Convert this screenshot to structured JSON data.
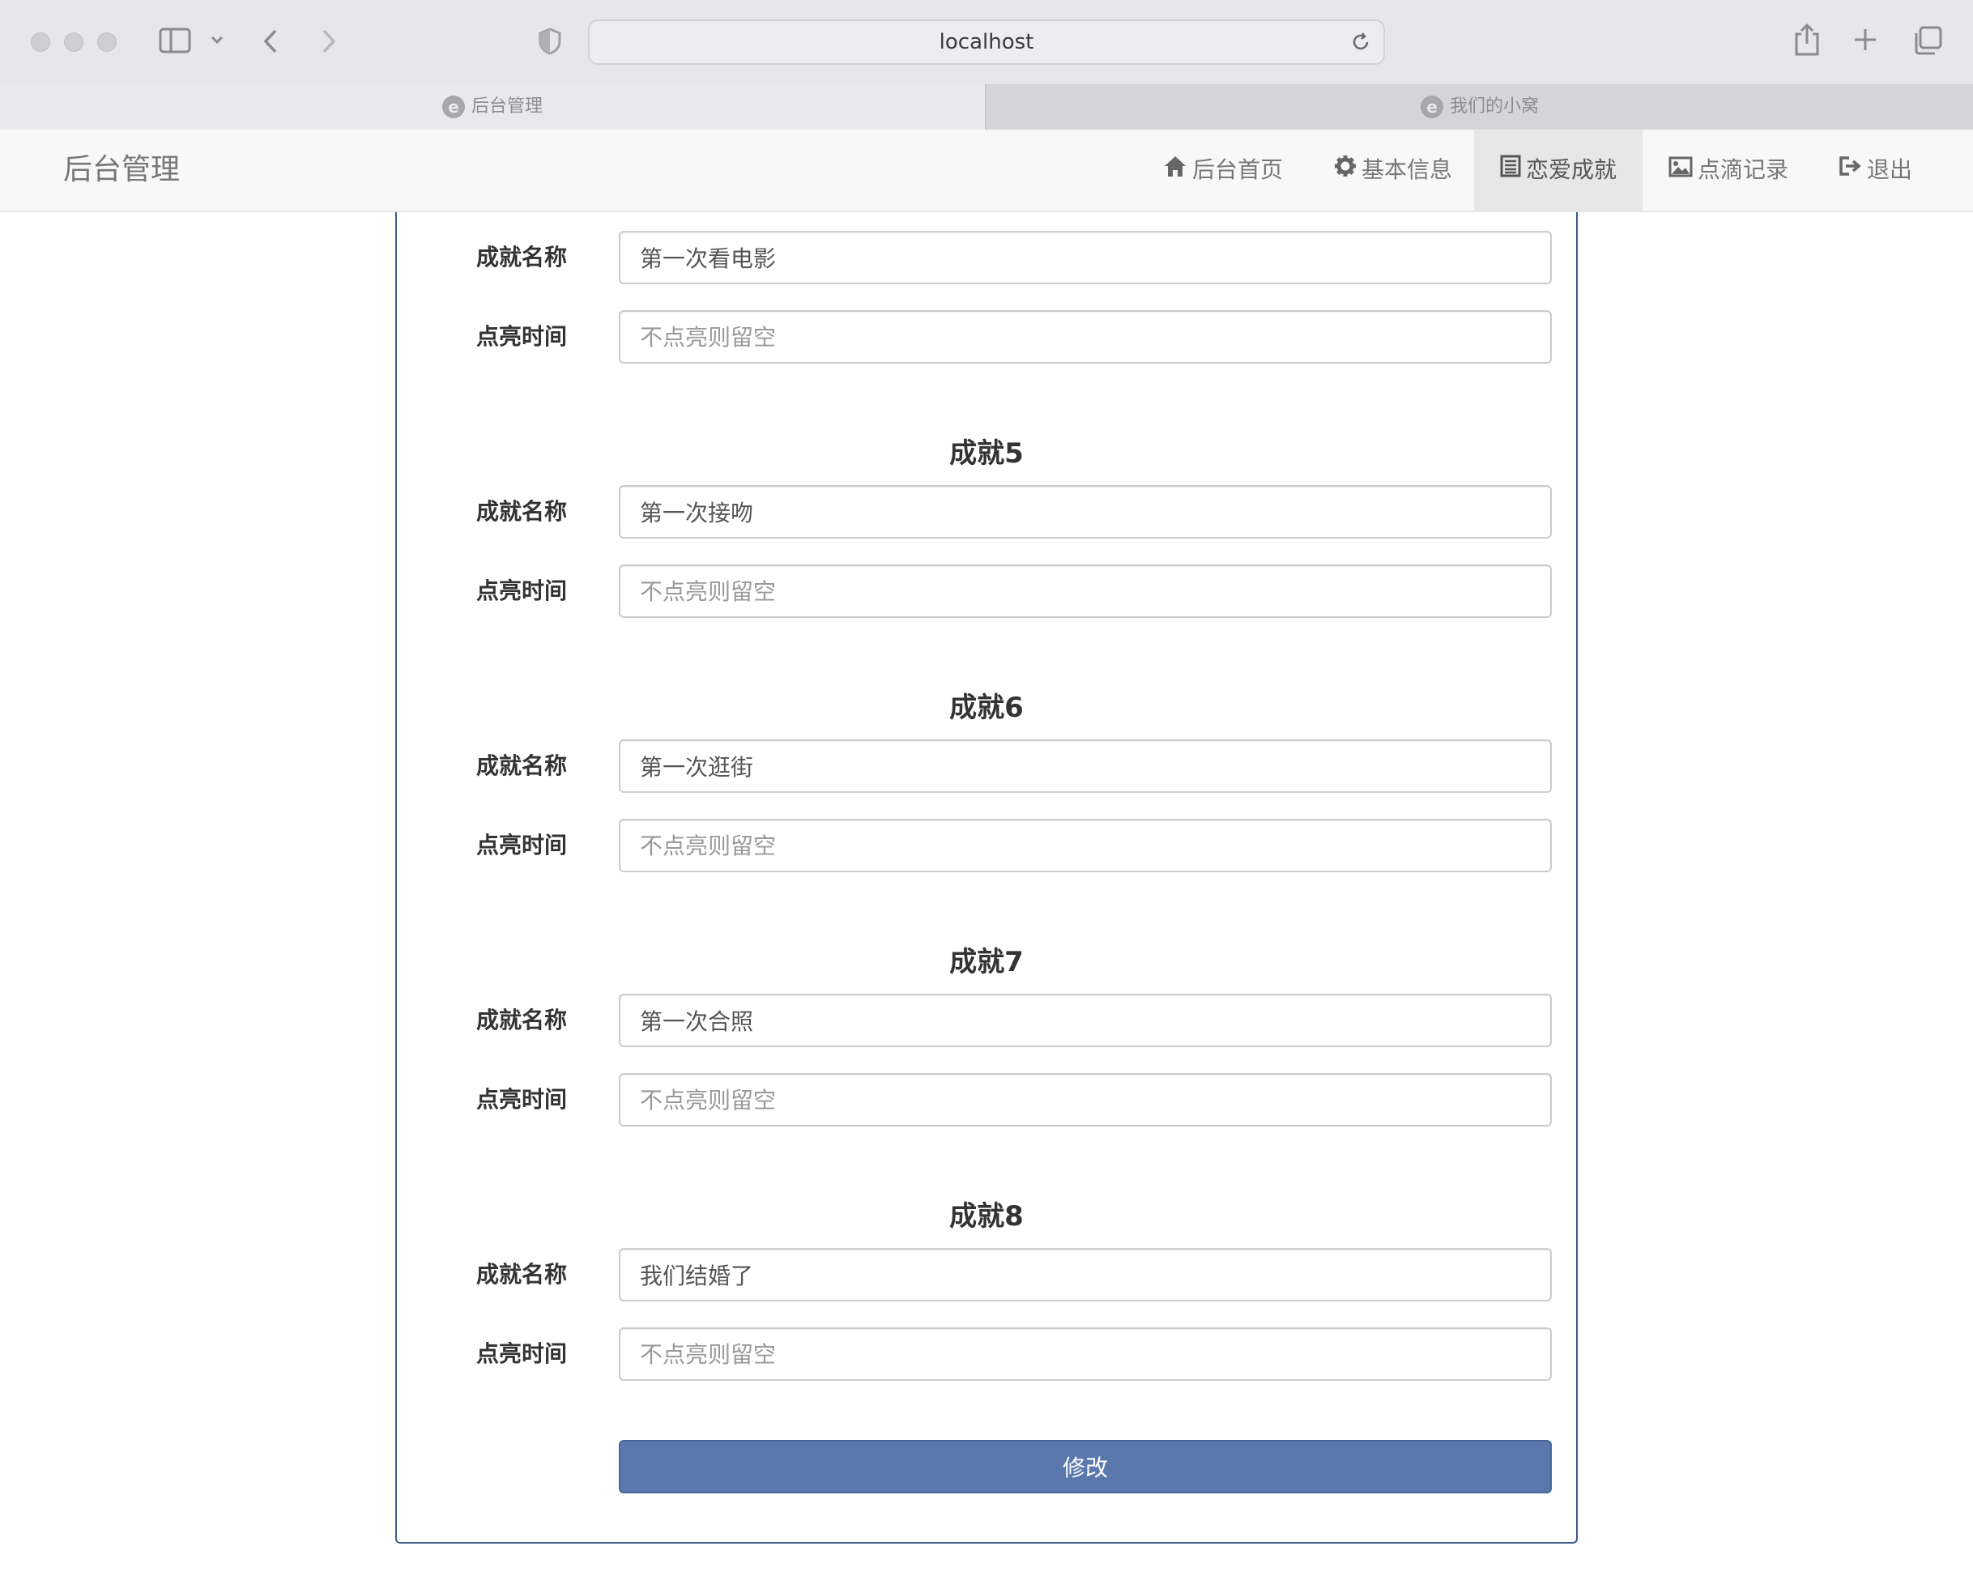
{
  "browser": {
    "url": "localhost",
    "tabs": [
      {
        "label": "后台管理"
      },
      {
        "label": "我们的小窝"
      }
    ]
  },
  "navbar": {
    "brand": "后台管理",
    "items": [
      {
        "label": "后台首页",
        "icon": "home-icon"
      },
      {
        "label": "基本信息",
        "icon": "gear-icon"
      },
      {
        "label": "恋爱成就",
        "icon": "list-icon"
      },
      {
        "label": "点滴记录",
        "icon": "picture-icon"
      },
      {
        "label": "退出",
        "icon": "logout-icon"
      }
    ]
  },
  "form": {
    "name_label": "成就名称",
    "time_label": "点亮时间",
    "time_placeholder": "不点亮则留空",
    "partial": {
      "name_value": "第一次看电影",
      "time_value": ""
    },
    "sections": [
      {
        "title": "成就5",
        "name_value": "第一次接吻",
        "time_value": ""
      },
      {
        "title": "成就6",
        "name_value": "第一次逛街",
        "time_value": ""
      },
      {
        "title": "成就7",
        "name_value": "第一次合照",
        "time_value": ""
      },
      {
        "title": "成就8",
        "name_value": "我们结婚了",
        "time_value": ""
      }
    ],
    "submit_label": "修改"
  },
  "colors": {
    "primary": "#5a78ac",
    "panel_border": "#3d5a8a",
    "navbar_bg": "#f8f8f8",
    "nav_active_bg": "#e7e7e7"
  }
}
